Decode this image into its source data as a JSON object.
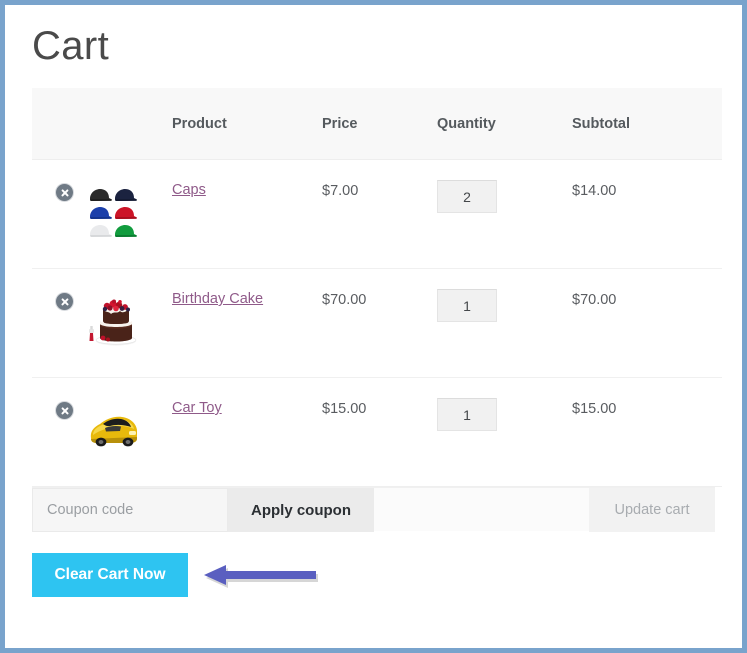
{
  "page": {
    "title": "Cart",
    "accent_button_color": "#2ec4f1",
    "frame_color": "#79a3cc",
    "link_color": "#8f5a89",
    "annotation_arrow_color": "#5a5fc0"
  },
  "table": {
    "headers": {
      "remove": "",
      "thumbnail": "",
      "product": "Product",
      "price": "Price",
      "quantity": "Quantity",
      "subtotal": "Subtotal"
    },
    "rows": [
      {
        "remove_label": "×",
        "thumbnail": "caps-thumbnail",
        "name": "Caps",
        "price": "$7.00",
        "quantity": "2",
        "subtotal": "$14.00"
      },
      {
        "remove_label": "×",
        "thumbnail": "birthday-cake-thumbnail",
        "name": "Birthday Cake",
        "price": "$70.00",
        "quantity": "1",
        "subtotal": "$70.00"
      },
      {
        "remove_label": "×",
        "thumbnail": "car-toy-thumbnail",
        "name": "Car Toy",
        "price": "$15.00",
        "quantity": "1",
        "subtotal": "$15.00"
      }
    ]
  },
  "actions": {
    "coupon_placeholder": "Coupon code",
    "coupon_value": "",
    "apply_coupon_label": "Apply coupon",
    "update_cart_label": "Update cart"
  },
  "footer": {
    "clear_cart_label": "Clear Cart Now"
  }
}
